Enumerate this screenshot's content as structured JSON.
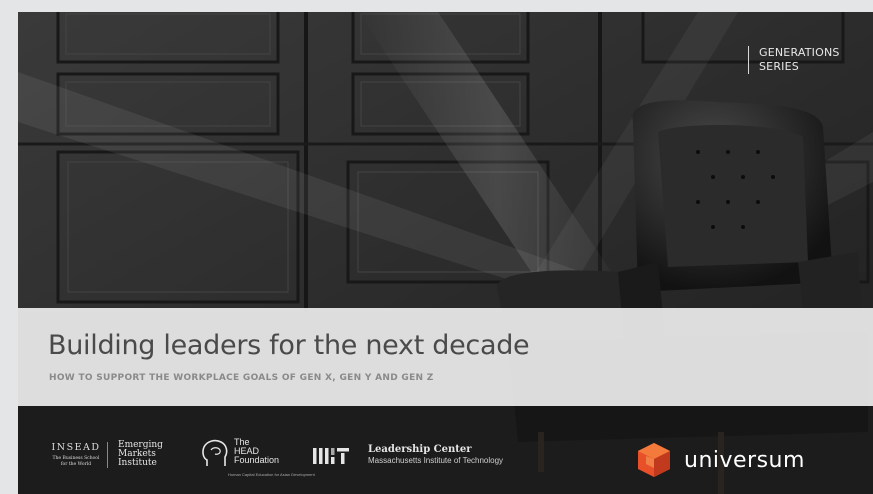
{
  "series_tag": {
    "line1": "GENERATIONS",
    "line2": "SERIES"
  },
  "title": "Building leaders for the next decade",
  "subtitle": "HOW TO SUPPORT THE WORKPLACE GOALS OF GEN X, GEN Y AND GEN Z",
  "logos": {
    "insead": {
      "name": "INSEAD",
      "tagline_1": "The Business School",
      "tagline_2": "for the World"
    },
    "emi": {
      "line1": "Emerging",
      "line2": "Markets",
      "line3": "Institute"
    },
    "head": {
      "line1": "The",
      "line2": "HEAD",
      "line3": "Foundation",
      "tagline": "Human Capital Education for Asian Development"
    },
    "mit": {
      "center": "Leadership Center",
      "institute": "Massachusetts Institute of Technology"
    },
    "universum": {
      "name": "universum"
    }
  },
  "colors": {
    "band": "#ececec",
    "title_text": "#4a4a4a",
    "universum_orange": "#e8502a"
  }
}
